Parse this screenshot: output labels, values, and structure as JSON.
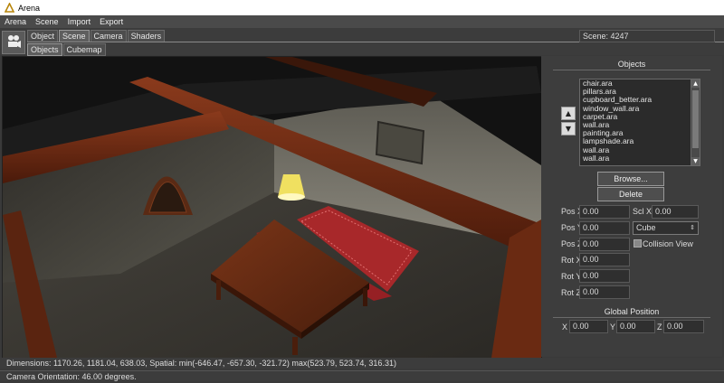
{
  "window": {
    "title": "Arena"
  },
  "menu": [
    "Arena",
    "Scene",
    "Import",
    "Export"
  ],
  "toolbar": {
    "icon": "camera-icon",
    "main_tabs": [
      "Object",
      "Scene",
      "Camera",
      "Shaders"
    ],
    "sub_tabs": [
      "Objects",
      "Cubemap"
    ],
    "scene_label": "Scene: 4247"
  },
  "objects_panel": {
    "title": "Objects",
    "items": [
      "chair.ara",
      "pillars.ara",
      "cupboard_better.ara",
      "window_wall.ara",
      "carpet.ara",
      "wall.ara",
      "painting.ara",
      "lampshade.ara",
      "wall.ara",
      "wall.ara"
    ],
    "browse_label": "Browse...",
    "delete_label": "Delete",
    "fields": {
      "pos_x_label": "Pos X",
      "pos_x": "0.00",
      "pos_y_label": "Pos Y",
      "pos_y": "0.00",
      "pos_z_label": "Pos Z",
      "pos_z": "0.00",
      "rot_x_label": "Rot X",
      "rot_x": "0.00",
      "rot_y_label": "Rot Y",
      "rot_y": "0.00",
      "rot_z_label": "Rot Z",
      "rot_z": "0.00",
      "scl_x_label": "Scl X",
      "scl_x": "0.00"
    },
    "shape_select": "Cube",
    "collision_label": "Collision View"
  },
  "global_position": {
    "title": "Global Position",
    "x_label": "X",
    "x": "0.00",
    "y_label": "Y",
    "y": "0.00",
    "z_label": "Z",
    "z": "0.00"
  },
  "status": {
    "dimensions": "Dimensions: 1170.26, 1181.04, 638.03, Spatial: min(-646.47, -657.30, -321.72) max(523.79, 523.74, 316.31)",
    "camera": "Camera Orientation: 46.00 degrees."
  },
  "colors": {
    "accent": "#ffffff",
    "panel": "#3d3d3d",
    "wood": "#6b2a14"
  }
}
